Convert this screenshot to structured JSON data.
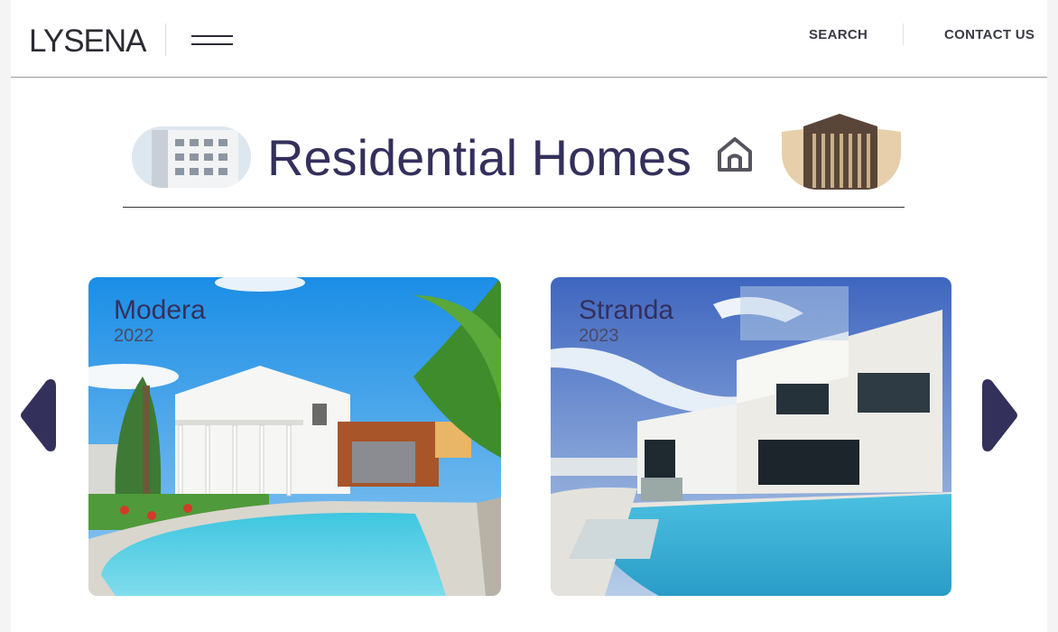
{
  "header": {
    "logo": "LYSENA",
    "nav": {
      "search_label": "SEARCH",
      "contact_label": "CONTACT US"
    },
    "menu_icon": "hamburger-icon"
  },
  "hero": {
    "title": "Residential Homes",
    "icon": "home-icon"
  },
  "carousel": {
    "prev_icon": "chevron-left-icon",
    "next_icon": "chevron-right-icon",
    "items": [
      {
        "name": "Modera",
        "year": "2022"
      },
      {
        "name": "Stranda",
        "year": "2023"
      }
    ]
  },
  "colors": {
    "accent": "#34305c",
    "text": "#2b2b33",
    "background": "#ffffff"
  }
}
